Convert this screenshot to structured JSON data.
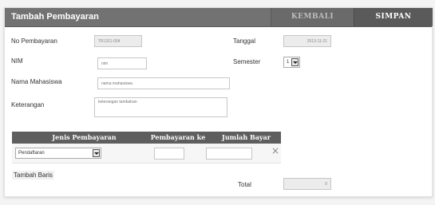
{
  "header": {
    "title": "Tambah Pembayaran",
    "back_label": "KEMBALI",
    "save_label": "SIMPAN"
  },
  "form": {
    "no_pembayaran": {
      "label": "No Pembayaran",
      "value": "TR1311-004"
    },
    "nim": {
      "label": "NIM",
      "placeholder": "nim"
    },
    "nama_mahasiswa": {
      "label": "Nama Mahasiswa",
      "placeholder": "nama mahasiswa"
    },
    "keterangan": {
      "label": "Keterangan",
      "placeholder": "keterangan tambahan"
    },
    "tanggal": {
      "label": "Tanggal",
      "value": "2013-11-21"
    },
    "semester": {
      "label": "Semester",
      "selected": "1"
    }
  },
  "table": {
    "columns": [
      "Jenis Pembayaran",
      "Pembayaran ke",
      "Jumlah Bayar"
    ],
    "rows": [
      {
        "jenis": "Pendaftaran",
        "pembayaran_ke": "",
        "jumlah_bayar": ""
      }
    ],
    "delete_symbol": "×",
    "add_row_label": "Tambah Baris"
  },
  "total": {
    "label": "Total",
    "value": "0"
  },
  "colors": {
    "header_bg": "#727272",
    "table_header_bg": "#5e5e5e",
    "readonly_bg": "#ececec"
  }
}
